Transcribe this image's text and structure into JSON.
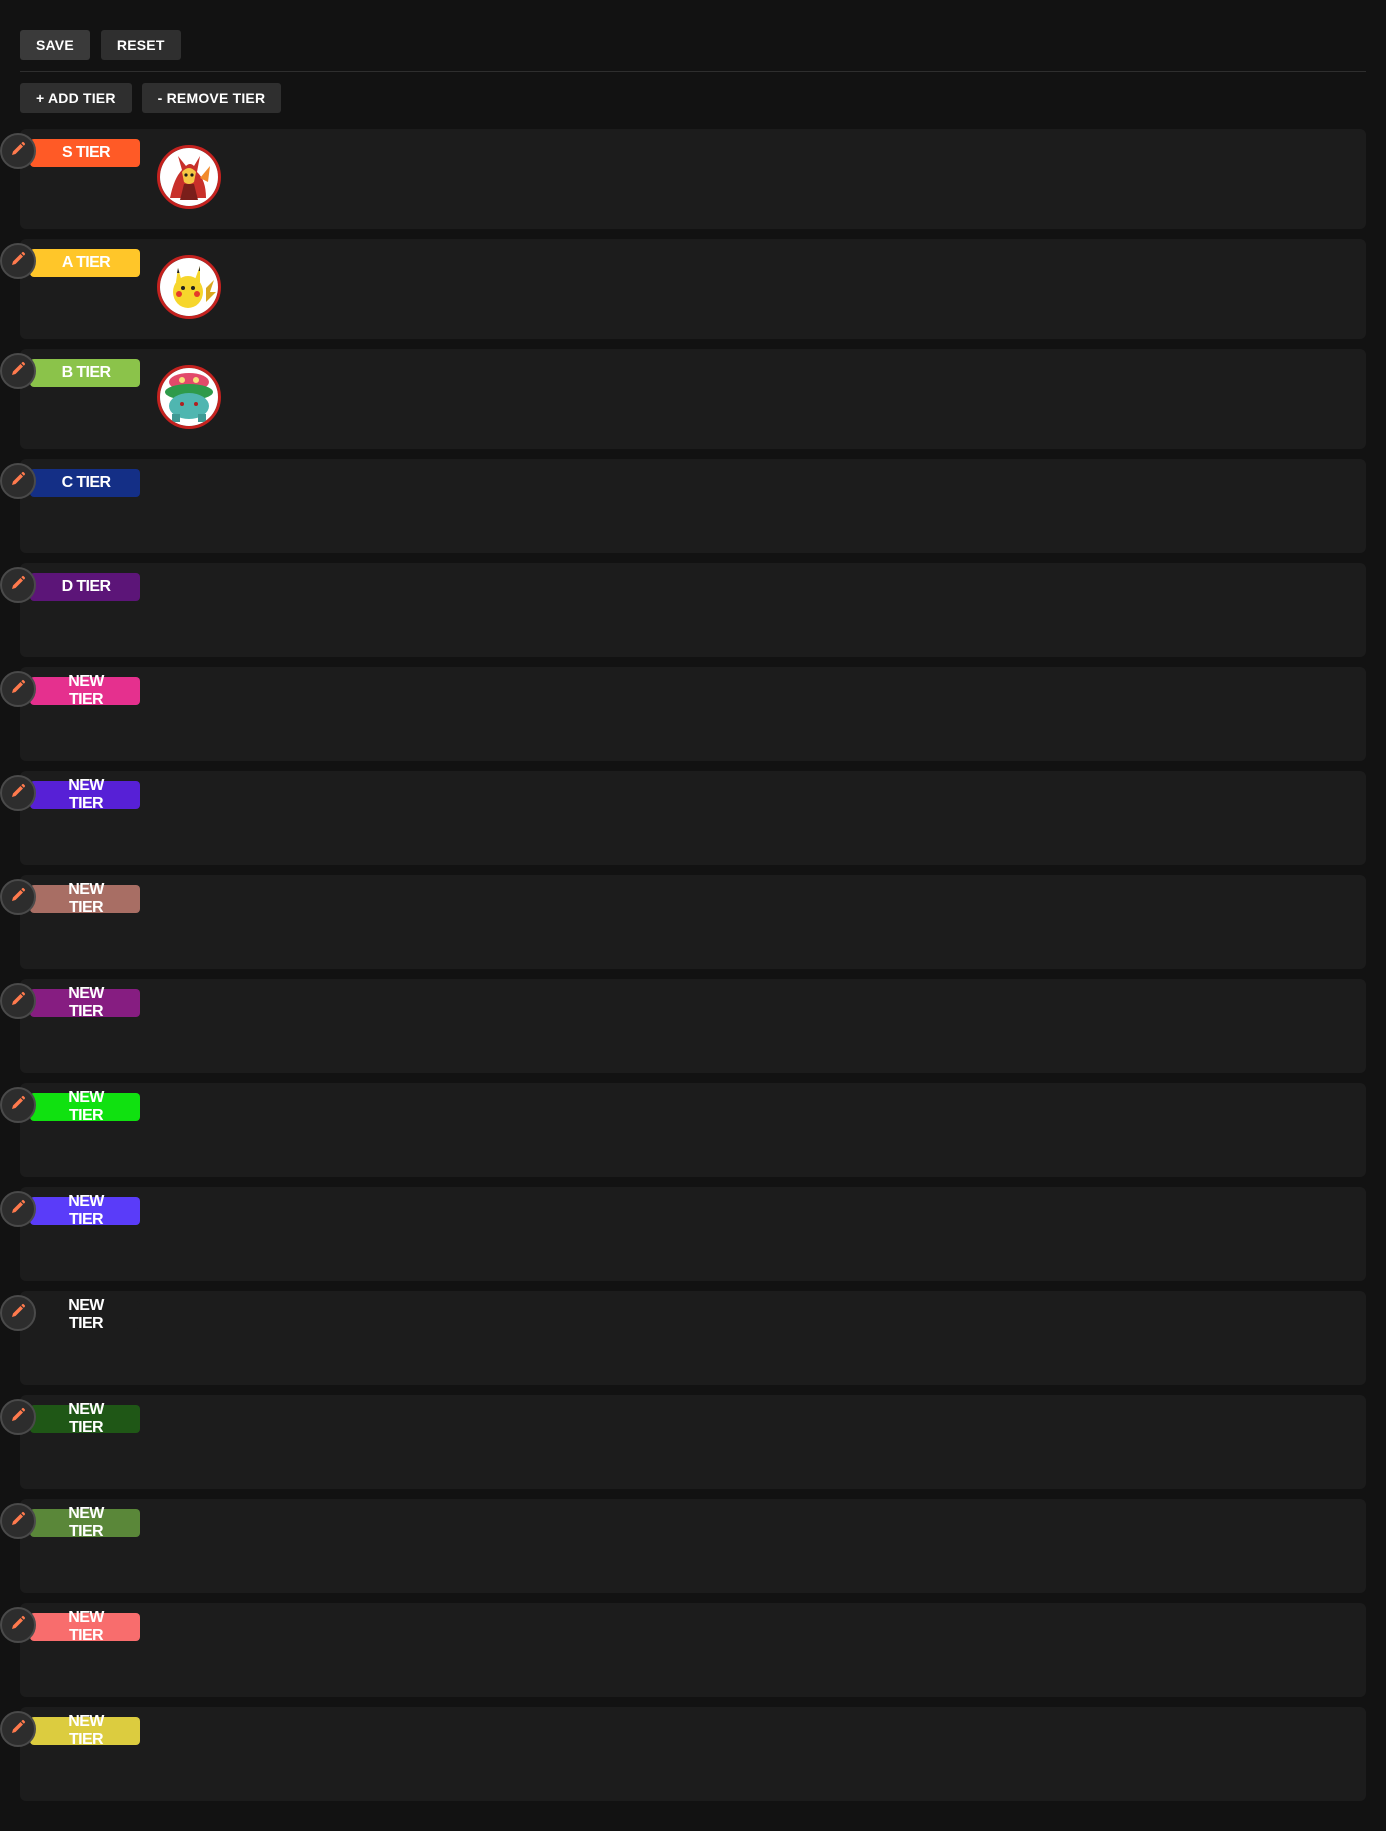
{
  "toolbar": {
    "save_label": "SAVE",
    "reset_label": "RESET",
    "add_tier_label": "+ ADD TIER",
    "remove_tier_label": "- REMOVE TIER"
  },
  "tiers": [
    {
      "label": "S TIER",
      "color": "#ff5a26",
      "items": [
        {
          "name": "delphox",
          "icon": "pokemon-delphox-icon"
        }
      ]
    },
    {
      "label": "A TIER",
      "color": "#ffc629",
      "items": [
        {
          "name": "pikachu",
          "icon": "pokemon-pikachu-icon"
        }
      ]
    },
    {
      "label": "B TIER",
      "color": "#8bc34a",
      "items": [
        {
          "name": "venusaur",
          "icon": "pokemon-venusaur-icon"
        }
      ]
    },
    {
      "label": "C TIER",
      "color": "#142f86",
      "items": []
    },
    {
      "label": "D TIER",
      "color": "#5c1578",
      "items": []
    },
    {
      "label": "NEW TIER",
      "color": "#e5308e",
      "items": []
    },
    {
      "label": "NEW TIER",
      "color": "#5720d6",
      "items": []
    },
    {
      "label": "NEW TIER",
      "color": "#a86e64",
      "items": []
    },
    {
      "label": "NEW TIER",
      "color": "#861d81",
      "items": []
    },
    {
      "label": "NEW TIER",
      "color": "#10e110",
      "items": []
    },
    {
      "label": "NEW TIER",
      "color": "#5a3cf9",
      "items": []
    },
    {
      "label": "NEW TIER",
      "color": "#1c1c1c",
      "items": []
    },
    {
      "label": "NEW TIER",
      "color": "#1f5716",
      "items": []
    },
    {
      "label": "NEW TIER",
      "color": "#5a8739",
      "items": []
    },
    {
      "label": "NEW TIER",
      "color": "#f86d6d",
      "items": []
    },
    {
      "label": "NEW TIER",
      "color": "#dccc3f",
      "items": []
    }
  ],
  "icons": {
    "edit": "pencil-icon",
    "edit_color": "#ff7a4d"
  }
}
